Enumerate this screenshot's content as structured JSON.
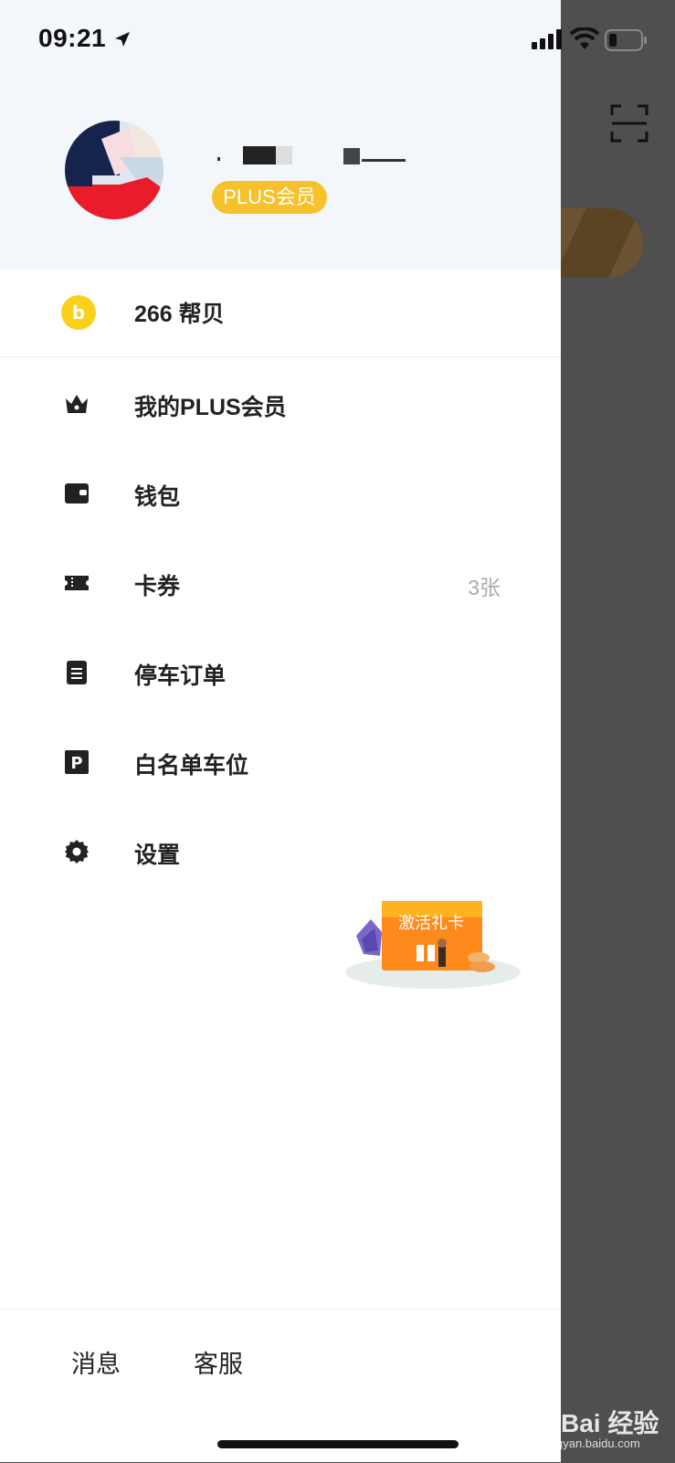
{
  "status": {
    "time": "09:21"
  },
  "profile": {
    "badge": "PLUS会员"
  },
  "points": {
    "label": "266 帮贝"
  },
  "menu": [
    {
      "label": "我的PLUS会员",
      "icon": "crown-icon",
      "extra": ""
    },
    {
      "label": "钱包",
      "icon": "wallet-icon",
      "extra": ""
    },
    {
      "label": "卡券",
      "icon": "ticket-icon",
      "extra": "3张"
    },
    {
      "label": "停车订单",
      "icon": "order-icon",
      "extra": ""
    },
    {
      "label": "白名单车位",
      "icon": "parking-icon",
      "extra": ""
    },
    {
      "label": "设置",
      "icon": "gear-icon",
      "extra": ""
    }
  ],
  "promo": {
    "label": "激活礼卡"
  },
  "bottom": {
    "messages": "消息",
    "service": "客服"
  },
  "watermark": {
    "text": "Bai 经验",
    "sub": "jingyan.baidu.com"
  },
  "colors": {
    "accent": "#f7c12b",
    "coin": "#f9d11b",
    "overlay": "#4f4f4f"
  }
}
